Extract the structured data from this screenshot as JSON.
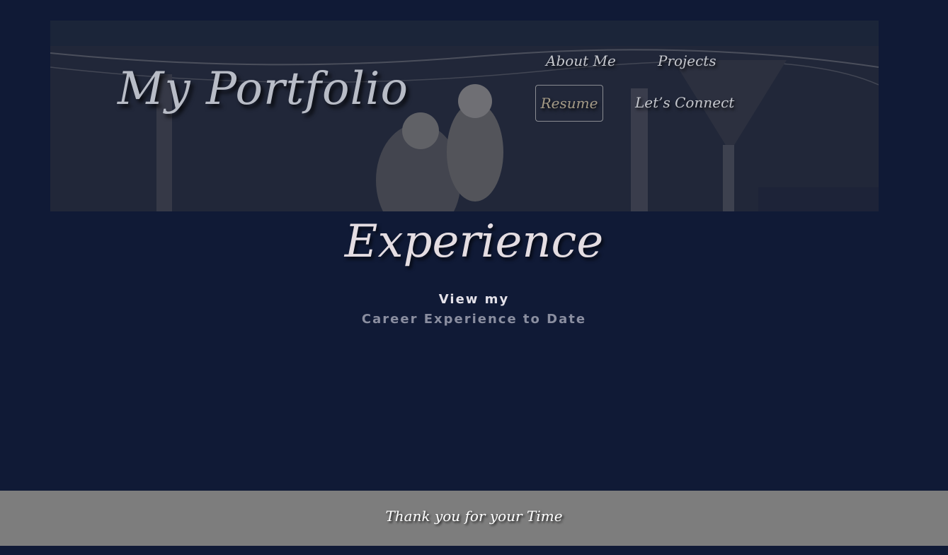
{
  "header": {
    "site_title": "My Portfolio",
    "nav": {
      "about": "About Me",
      "projects": "Projects",
      "resume": "Resume",
      "connect": "Let’s Connect"
    }
  },
  "main": {
    "heading": "Experience",
    "subtext_line1": "View my",
    "subtext_line2": "Career Experience to Date"
  },
  "footer": {
    "text": "Thank you for your Time"
  },
  "colors": {
    "page_background": "#101a36",
    "footer_background": "#7d7d7d",
    "active_nav_text": "#a49a86"
  }
}
